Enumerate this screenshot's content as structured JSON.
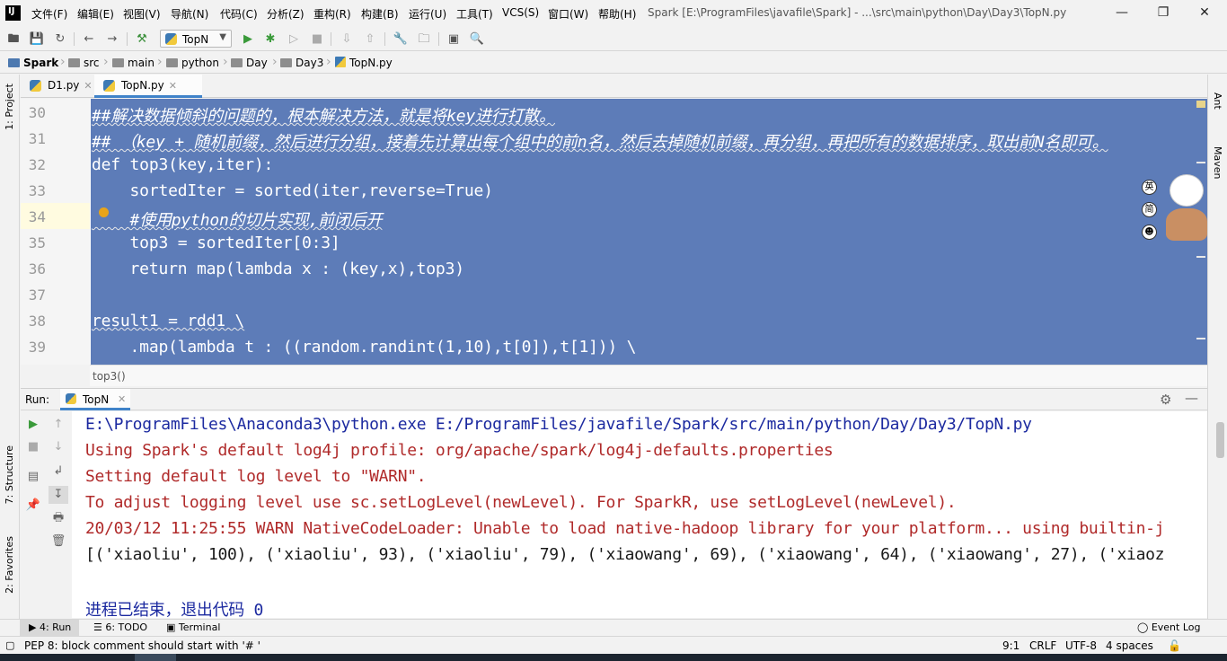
{
  "menubar": {
    "items": [
      "文件(F)",
      "编辑(E)",
      "视图(V)",
      "导航(N)",
      "代码(C)",
      "分析(Z)",
      "重构(R)",
      "构建(B)",
      "运行(U)",
      "工具(T)",
      "VCS(S)",
      "窗口(W)",
      "帮助(H)"
    ],
    "title": "Spark [E:\\ProgramFiles\\javafile\\Spark] - ...\\src\\main\\python\\Day\\Day3\\TopN.py"
  },
  "toolbar": {
    "run_config": "TopN"
  },
  "breadcrumb": [
    "Spark",
    "src",
    "main",
    "python",
    "Day",
    "Day3",
    "TopN.py"
  ],
  "left_tools": [
    "1: Project",
    "7: Structure",
    "2: Favorites"
  ],
  "right_tools": [
    "Ant",
    "Maven"
  ],
  "editor_tabs": [
    {
      "label": "D1.py"
    },
    {
      "label": "TopN.py",
      "active": true
    }
  ],
  "editor": {
    "lines": [
      {
        "n": "30",
        "text": "##解决数据倾斜的问题的，根本解决方法，就是将key进行打散。"
      },
      {
        "n": "31",
        "text": "## （key + 随机前缀，然后进行分组，接着先计算出每个组中的前n名，然后去掉随机前缀，再分组，再把所有的数据排序，取出前N名即可。"
      },
      {
        "n": "32",
        "text": "def top3(key,iter):"
      },
      {
        "n": "33",
        "text": "    sortedIter = sorted(iter,reverse=True)"
      },
      {
        "n": "34",
        "text": "    #使用python的切片实现,前闭后开"
      },
      {
        "n": "35",
        "text": "    top3 = sortedIter[0:3]"
      },
      {
        "n": "36",
        "text": "    return map(lambda x : (key,x),top3)"
      },
      {
        "n": "37",
        "text": ""
      },
      {
        "n": "38",
        "text": "result1 = rdd1 \\"
      },
      {
        "n": "39",
        "text": "    .map(lambda t : ((random.randint(1,10),t[0]),t[1])) \\"
      }
    ],
    "breadcrumb_hint": "top3()"
  },
  "ime": {
    "lang": "英",
    "mode": "简"
  },
  "run_panel": {
    "label": "Run:",
    "tab": "TopN",
    "console": [
      {
        "text": "E:\\ProgramFiles\\Anaconda3\\python.exe E:/ProgramFiles/javafile/Spark/src/main/python/Day/Day3/TopN.py",
        "color": "#1c2aa0"
      },
      {
        "text": "Using Spark's default log4j profile: org/apache/spark/log4j-defaults.properties",
        "color": "#b02a2a"
      },
      {
        "text": "Setting default log level to \"WARN\".",
        "color": "#b02a2a"
      },
      {
        "text": "To adjust logging level use sc.setLogLevel(newLevel). For SparkR, use setLogLevel(newLevel).",
        "color": "#b02a2a"
      },
      {
        "text": "20/03/12 11:25:55 WARN NativeCodeLoader: Unable to load native-hadoop library for your platform... using builtin-j",
        "color": "#b02a2a"
      },
      {
        "text": "[('xiaoliu', 100), ('xiaoliu', 93), ('xiaoliu', 79), ('xiaowang', 69), ('xiaowang', 64), ('xiaowang', 27), ('xiaoz",
        "color": "#1a1a1a"
      },
      {
        "text": "",
        "color": "#1a1a1a"
      },
      {
        "text": "进程已结束，退出代码 0",
        "color": "#1c2aa0"
      }
    ]
  },
  "bottom_tools": {
    "run": "4: Run",
    "todo": "6: TODO",
    "terminal": "Terminal",
    "event_log": "Event Log"
  },
  "status": {
    "message": "PEP 8: block comment should start with '# '",
    "position": "9:1",
    "line_sep": "CRLF",
    "encoding": "UTF-8",
    "indent": "4 spaces"
  },
  "colors": {
    "selection": "#5d7cb8",
    "accent": "#4083c9"
  }
}
